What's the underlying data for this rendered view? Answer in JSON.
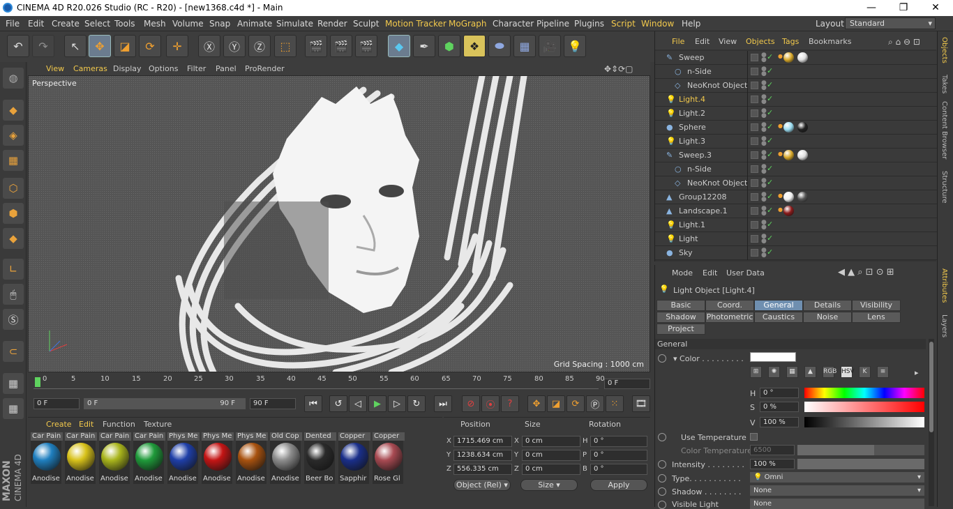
{
  "window": {
    "title": "CINEMA 4D R20.026 Studio (RC - R20) - [new1368.c4d *] - Main",
    "min": "—",
    "max": "❐",
    "close": "✕"
  },
  "menu": [
    "File",
    "Edit",
    "Create",
    "Select",
    "Tools",
    "Mesh",
    "Volume",
    "Snap",
    "Animate",
    "Simulate",
    "Render",
    "Sculpt",
    "Motion Tracker",
    "MoGraph",
    "Character",
    "Pipeline",
    "Plugins",
    "Script",
    "Window",
    "Help"
  ],
  "layout": {
    "label": "Layout:",
    "value": "Standard"
  },
  "viewport": {
    "menu": [
      "View",
      "Cameras",
      "Display",
      "Options",
      "Filter",
      "Panel",
      "ProRender"
    ],
    "camera": "Perspective",
    "grid_spacing": "Grid Spacing : 1000 cm"
  },
  "timeline": {
    "ticks": [
      "0",
      "5",
      "10",
      "15",
      "20",
      "25",
      "30",
      "35",
      "40",
      "45",
      "50",
      "55",
      "60",
      "65",
      "70",
      "75",
      "80",
      "85",
      "90"
    ],
    "current_frame": "0 F",
    "start": "0 F",
    "range_start": "0 F",
    "range_end": "90 F",
    "end": "90 F"
  },
  "materials": {
    "menu": [
      "Create",
      "Edit",
      "Function",
      "Texture"
    ],
    "items": [
      {
        "top": "Car Pain",
        "label": "Anodise",
        "color": "#1f7fbf"
      },
      {
        "top": "Car Pain",
        "label": "Anodise",
        "color": "#d8c21a"
      },
      {
        "top": "Car Pain",
        "label": "Anodise",
        "color": "#a9b51c"
      },
      {
        "top": "Car Pain",
        "label": "Anodise",
        "color": "#1f9a3a"
      },
      {
        "top": "Phys Me",
        "label": "Anodise",
        "color": "#1f3fa8"
      },
      {
        "top": "Phys Me",
        "label": "Anodise",
        "color": "#c41515"
      },
      {
        "top": "Phys Me",
        "label": "Anodise",
        "color": "#a8520f"
      },
      {
        "top": "Old Cop",
        "label": "Anodise",
        "color": "#8d8d8d"
      },
      {
        "top": "Dented",
        "label": "Beer Bo",
        "color": "#2a2a2a"
      },
      {
        "top": "Copper",
        "label": "Sapphir",
        "color": "#1a2f8a"
      },
      {
        "top": "Copper",
        "label": "Rose Gl",
        "color": "#a84a52"
      }
    ]
  },
  "coords": {
    "headers": [
      "Position",
      "Size",
      "Rotation"
    ],
    "rows": [
      {
        "axis": "X",
        "pos": "1715.469 cm",
        "saxis": "X",
        "size": "0 cm",
        "raxis": "H",
        "rot": "0 °"
      },
      {
        "axis": "Y",
        "pos": "1238.634 cm",
        "saxis": "Y",
        "size": "0 cm",
        "raxis": "P",
        "rot": "0 °"
      },
      {
        "axis": "Z",
        "pos": "556.335 cm",
        "saxis": "Z",
        "size": "0 cm",
        "raxis": "B",
        "rot": "0 °"
      }
    ],
    "mode": "Object (Rel)",
    "size_mode": "Size",
    "apply": "Apply"
  },
  "objects": {
    "menu": [
      "File",
      "Edit",
      "View",
      "Objects",
      "Tags",
      "Bookmarks"
    ],
    "items": [
      {
        "name": "Sweep",
        "icon": "✎",
        "indent": 0,
        "hl": false
      },
      {
        "name": "n-Side",
        "icon": "○",
        "indent": 1,
        "hl": false
      },
      {
        "name": "NeoKnot Object",
        "icon": "◇",
        "indent": 1,
        "hl": false
      },
      {
        "name": "Light.4",
        "icon": "💡",
        "indent": 0,
        "hl": true
      },
      {
        "name": "Light.2",
        "icon": "💡",
        "indent": 0,
        "hl": false
      },
      {
        "name": "Sphere",
        "icon": "●",
        "indent": 0,
        "hl": false
      },
      {
        "name": "Light.3",
        "icon": "💡",
        "indent": 0,
        "hl": false
      },
      {
        "name": "Sweep.3",
        "icon": "✎",
        "indent": 0,
        "hl": false
      },
      {
        "name": "n-Side",
        "icon": "○",
        "indent": 1,
        "hl": false
      },
      {
        "name": "NeoKnot Object",
        "icon": "◇",
        "indent": 1,
        "hl": false
      },
      {
        "name": "Group12208",
        "icon": "▲",
        "indent": 0,
        "hl": false
      },
      {
        "name": "Landscape.1",
        "icon": "▲",
        "indent": 0,
        "hl": false
      },
      {
        "name": "Light.1",
        "icon": "💡",
        "indent": 0,
        "hl": false
      },
      {
        "name": "Light",
        "icon": "💡",
        "indent": 0,
        "hl": false
      },
      {
        "name": "Sky",
        "icon": "●",
        "indent": 0,
        "hl": false
      }
    ]
  },
  "attributes": {
    "menu": [
      "Mode",
      "Edit",
      "User Data"
    ],
    "title": "Light Object [Light.4]",
    "tabs_row1": [
      "Basic",
      "Coord.",
      "General",
      "Details",
      "Visibility"
    ],
    "tabs_row2": [
      "Shadow",
      "Photometric",
      "Caustics",
      "Noise",
      "Lens"
    ],
    "tabs_row3": [
      "Project"
    ],
    "section": "General",
    "color_label": "Color . . . . . . . . .",
    "h": "0 °",
    "s": "0 %",
    "v": "100 %",
    "use_temp": "Use Temperature",
    "color_temp_label": "Color Temperature",
    "color_temp": "6500",
    "intensity_label": "Intensity . . . . . . . .",
    "intensity": "100 %",
    "type_label": "Type. . . . . . . . . . .",
    "type": "Omni",
    "shadow_label": "Shadow . . . . . . . .",
    "shadow": "None",
    "visible_label": "Visible Light",
    "visible": "None",
    "mode_icons": [
      "RGB",
      "HSV",
      "K"
    ]
  },
  "sidetabs": [
    "Objects",
    "Takes",
    "Content Browser",
    "Structure",
    "Attributes",
    "Layers"
  ],
  "brand": {
    "maxon": "MAXON",
    "c4d": "CINEMA 4D"
  }
}
